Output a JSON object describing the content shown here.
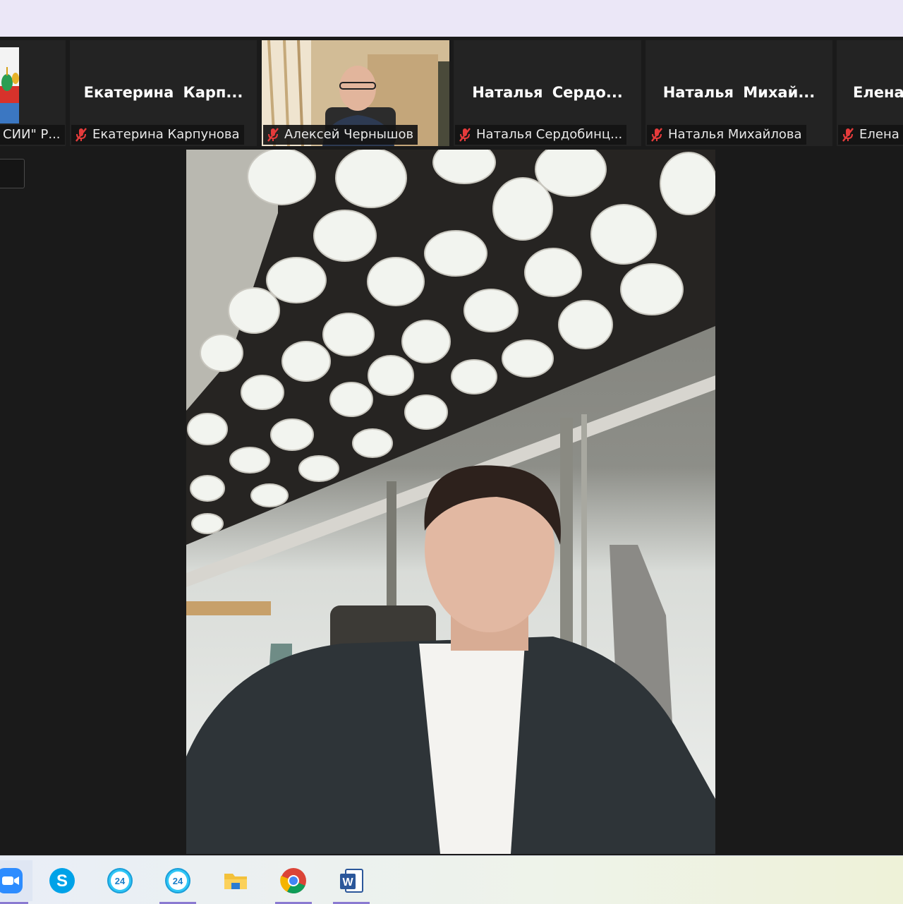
{
  "window": {
    "title_bar_color": "#ebe7f7"
  },
  "participants": [
    {
      "name": "",
      "label": "СИИ\" Р...",
      "has_video": true,
      "muted": false
    },
    {
      "name": "Екатерина Карп...",
      "label": "Екатерина Карпунова",
      "has_video": false,
      "muted": true
    },
    {
      "name": "",
      "label": "Алексей Чернышов",
      "has_video": true,
      "muted": true
    },
    {
      "name": "Наталья Сердо...",
      "label": "Наталья Сердобинц...",
      "has_video": false,
      "muted": true
    },
    {
      "name": "Наталья Михай...",
      "label": "Наталья Михайлова",
      "has_video": false,
      "muted": true
    },
    {
      "name": "Елена",
      "label": "Елена",
      "has_video": false,
      "muted": true
    }
  ],
  "active_speaker": {
    "video": "speaker-video"
  },
  "taskbar": {
    "apps": [
      {
        "icon": "zoom-icon",
        "active": true
      },
      {
        "icon": "skype-icon",
        "active": false,
        "glyph": "S"
      },
      {
        "icon": "bitrix24-icon",
        "active": false,
        "glyph": "24"
      },
      {
        "icon": "bitrix24-icon",
        "active": false,
        "glyph": "24"
      },
      {
        "icon": "file-explorer-icon",
        "active": false
      },
      {
        "icon": "chrome-icon",
        "active": false
      },
      {
        "icon": "word-icon",
        "active": false,
        "glyph": "W"
      }
    ]
  },
  "colors": {
    "muted_icon": "#e53b3b",
    "background": "#1a1a1a"
  }
}
